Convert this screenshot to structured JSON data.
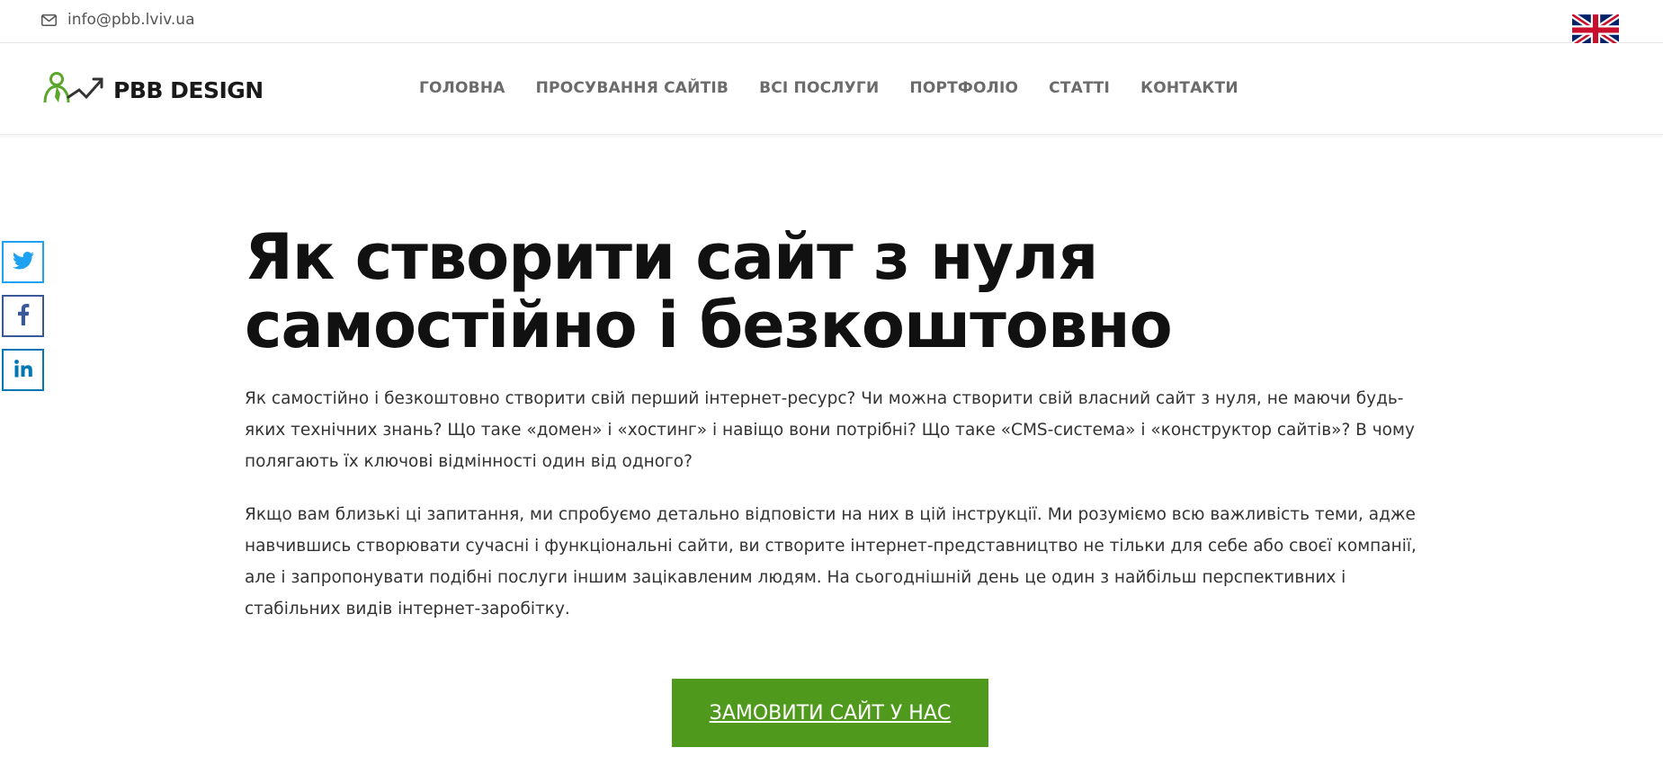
{
  "topbar": {
    "email": "info@pbb.lviv.ua",
    "email_icon": "envelope-icon",
    "language_flag": "uk-flag-icon"
  },
  "header": {
    "logo_text": "PBB DESIGN",
    "nav": [
      {
        "label": "ГОЛОВНА"
      },
      {
        "label": "ПРОСУВАННЯ САЙТІВ"
      },
      {
        "label": "ВСІ ПОСЛУГИ"
      },
      {
        "label": "ПОРТФОЛІО"
      },
      {
        "label": "СТАТТІ"
      },
      {
        "label": "КОНТАКТИ"
      }
    ]
  },
  "social": {
    "twitter_icon": "twitter-icon",
    "facebook_icon": "facebook-icon",
    "linkedin_icon": "linkedin-icon",
    "twitter_color": "#1da1f2",
    "facebook_color": "#3b5998",
    "linkedin_color": "#0077b5"
  },
  "article": {
    "title_line1": "Як створити сайт з нуля",
    "title_line2": "самостійно і безкоштовно",
    "paragraph1": "Як самостійно і безкоштовно створити свій перший інтернет-ресурс? Чи можна створити свій власний сайт з нуля, не маючи будь-яких технічних знань? Що таке «домен» і «хостинг» і навіщо вони потрібні? Що таке «CMS-система» і «конструктор сайтів»? В чому полягають їх ключові відмінності один від одного?",
    "paragraph2": "Якщо вам близькі ці запитання, ми спробуємо детально відповісти на них в цій інструкції. Ми розуміємо всю важливість теми, адже навчившись створювати сучасні і функціональні сайти, ви створите інтернет-представництво не тільки для себе або своєї компанії, але і запропонувати подібні послуги іншим зацікавленим людям. На сьогоднішній день це один з найбільш перспективних і стабільних видів інтернет-заробітку."
  },
  "cta": {
    "label": "ЗАМОВИТИ САЙТ У НАС",
    "color": "#4f9a1c"
  }
}
